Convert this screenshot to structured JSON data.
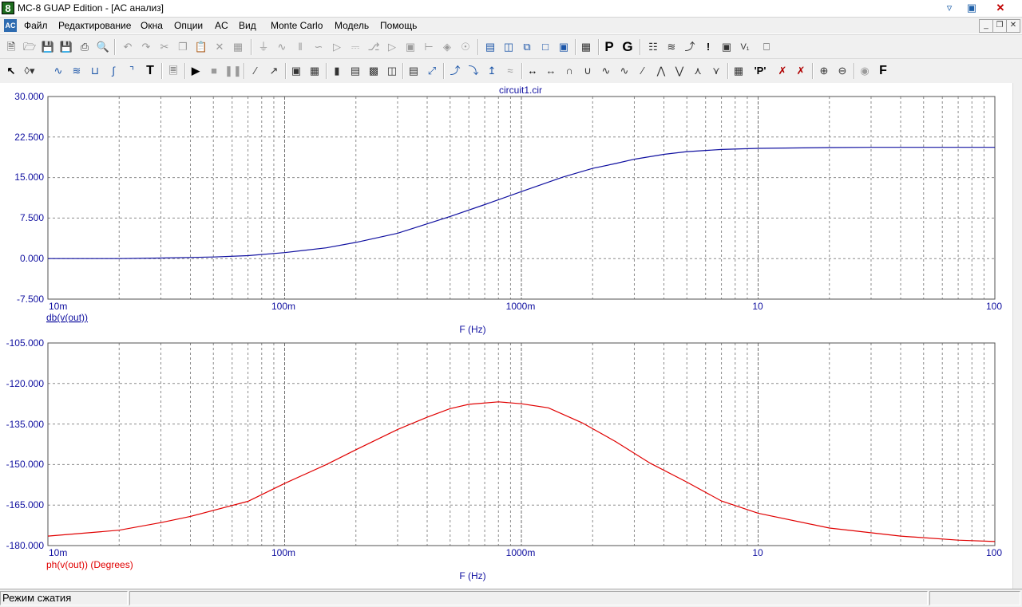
{
  "window": {
    "title": "MC-8 GUAP Edition - [AC анализ]",
    "app_icon_text": "8"
  },
  "menu": {
    "items": [
      "Файл",
      "Редактирование",
      "Окна",
      "Опции",
      "AC",
      "Вид",
      "Monte Carlo",
      "Модель",
      "Помощь"
    ]
  },
  "toolbar1": {
    "icons": [
      "new-file-icon",
      "open-file-icon",
      "save-icon",
      "save-all-icon",
      "print-icon",
      "print-preview-icon",
      "undo-icon",
      "redo-icon",
      "cut-icon",
      "copy-icon",
      "paste-icon",
      "delete-icon",
      "select-all-icon",
      "ground-icon",
      "resistor-icon",
      "capacitor-icon",
      "inductor-icon",
      "diode-icon",
      "battery-icon",
      "transistor-icon",
      "buffer-icon",
      "jumper-icon",
      "flag-icon",
      "node-icon",
      "gate-icon",
      "split-horizontal-icon",
      "split-vertical-icon",
      "cascade-icon",
      "tile-icon",
      "window-icon",
      "calculator-icon",
      "p-icon",
      "g-icon",
      "netlist-icon",
      "waveform-icon",
      "probe-icon",
      "info-icon",
      "preview-icon",
      "vs-icon",
      "zoom-window-icon"
    ]
  },
  "toolbar2": {
    "icons": [
      "select-arrow-icon",
      "component-icon",
      "wire-icon",
      "bus-icon",
      "text-icon",
      "grid-icon",
      "run-icon",
      "stop-icon",
      "pause-icon",
      "line-icon",
      "arrow-icon",
      "rectangle-icon",
      "table-icon",
      "grid-bars-icon",
      "grid-lines-icon",
      "grid-dots-icon",
      "split-icon",
      "cursor-icon",
      "peak-icon",
      "valley-icon",
      "high-icon",
      "low-icon",
      "slope-icon",
      "minimum-icon",
      "maximum-icon",
      "inflection-icon",
      "bottom-icon",
      "top-icon",
      "crossing-icon",
      "tabulate-icon",
      "label-p-icon",
      "mark-x-icon",
      "mark-y-icon",
      "zoom-in-icon",
      "zoom-out-icon",
      "sphere-icon",
      "font-icon"
    ]
  },
  "plot_top": {
    "title": "circuit1.cir",
    "expression": "db(v(out))",
    "xlabel": "F (Hz)",
    "y_ticks": [
      "30.000",
      "22.500",
      "15.000",
      "7.500",
      "0.000",
      "-7.500"
    ],
    "x_ticks": [
      "10m",
      "100m",
      "1000m",
      "10",
      "100"
    ],
    "line_color": "#1010a0"
  },
  "plot_bottom": {
    "expression": "ph(v(out)) (Degrees)",
    "xlabel": "F (Hz)",
    "y_ticks": [
      "-105.000",
      "-120.000",
      "-135.000",
      "-150.000",
      "-165.000",
      "-180.000"
    ],
    "x_ticks": [
      "10m",
      "100m",
      "1000m",
      "10",
      "100"
    ],
    "line_color": "#e00000"
  },
  "chart_data": [
    {
      "type": "line",
      "title": "circuit1.cir",
      "xlabel": "F (Hz)",
      "ylabel": "",
      "x_scale": "log",
      "xlim": [
        0.01,
        100
      ],
      "ylim": [
        -7.5,
        30
      ],
      "grid": true,
      "series": [
        {
          "name": "db(v(out))",
          "x": [
            0.01,
            0.02,
            0.03,
            0.05,
            0.07,
            0.1,
            0.15,
            0.2,
            0.3,
            0.5,
            0.7,
            1,
            1.5,
            2,
            2.5,
            3,
            4,
            5,
            7,
            10,
            20,
            30,
            50,
            100
          ],
          "y": [
            0.0,
            0.0,
            0.1,
            0.3,
            0.55,
            1.1,
            2.0,
            3.0,
            4.7,
            7.8,
            10.0,
            12.4,
            15.1,
            16.7,
            17.6,
            18.4,
            19.3,
            19.8,
            20.2,
            20.4,
            20.55,
            20.6,
            20.6,
            20.6
          ]
        }
      ]
    },
    {
      "type": "line",
      "title": "",
      "xlabel": "F (Hz)",
      "ylabel": "",
      "x_scale": "log",
      "xlim": [
        0.01,
        100
      ],
      "ylim": [
        -180,
        -105
      ],
      "grid": true,
      "series": [
        {
          "name": "ph(v(out)) (Degrees)",
          "x": [
            0.01,
            0.02,
            0.03,
            0.04,
            0.07,
            0.1,
            0.15,
            0.2,
            0.3,
            0.4,
            0.5,
            0.6,
            0.8,
            1,
            1.3,
            1.8,
            2.5,
            3.5,
            5,
            7,
            10,
            20,
            40,
            70,
            100
          ],
          "y": [
            -176.5,
            -174.3,
            -171.5,
            -169.2,
            -163.6,
            -157.0,
            -150.0,
            -144.5,
            -137.0,
            -132.5,
            -129.3,
            -127.7,
            -126.8,
            -127.5,
            -129.0,
            -134.5,
            -141.5,
            -149.5,
            -156.5,
            -163.5,
            -168.0,
            -173.5,
            -176.5,
            -178.0,
            -178.5
          ]
        }
      ]
    }
  ],
  "status": {
    "mode": "Режим сжатия",
    "panel2": "",
    "panel3": ""
  }
}
